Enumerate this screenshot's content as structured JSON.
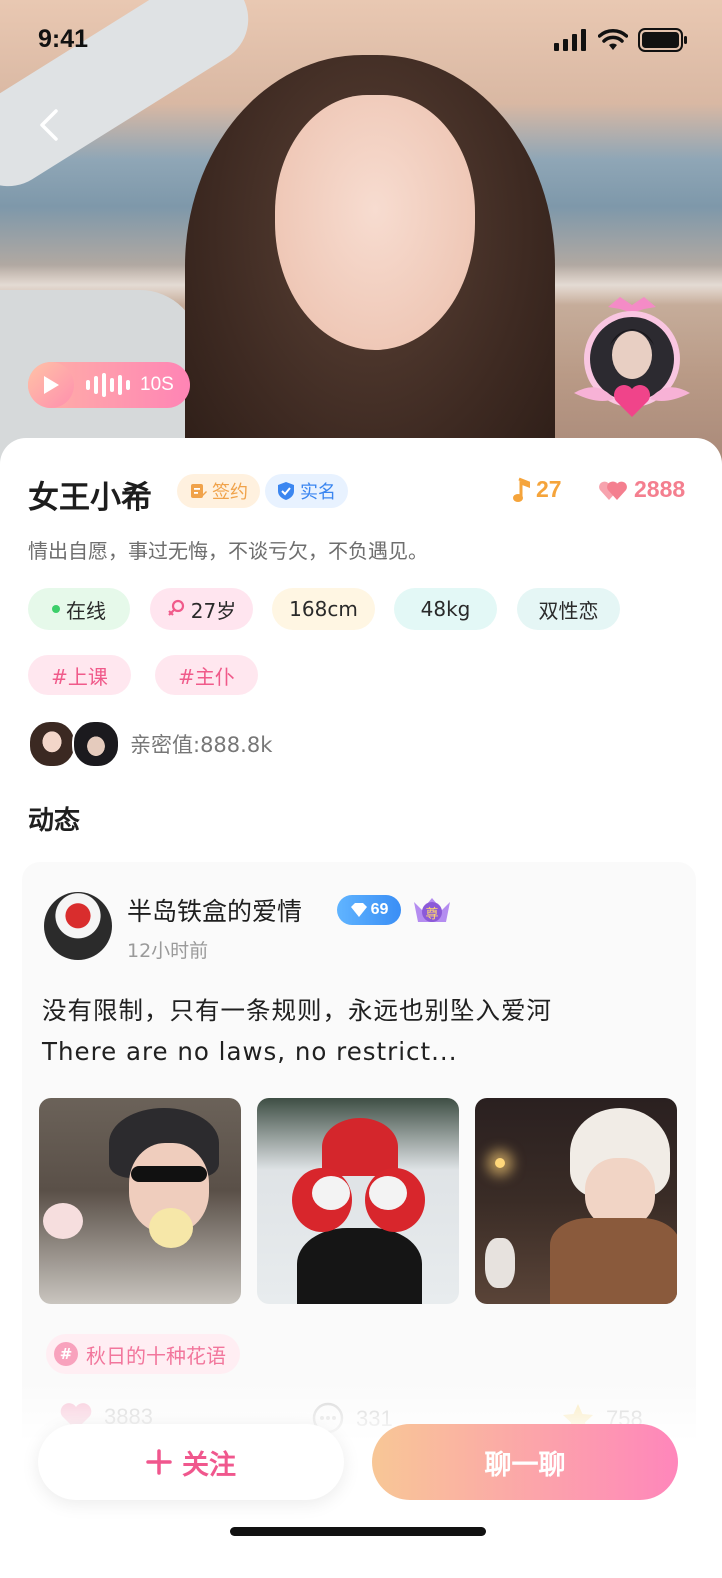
{
  "status_bar": {
    "time": "9:41"
  },
  "voice_intro": {
    "duration": "10S"
  },
  "profile": {
    "name": "女王小希",
    "badges": {
      "signed": "签约",
      "verified": "实名"
    },
    "stats": {
      "music": "27",
      "likes": "2888"
    },
    "bio": "情出自愿，事过无悔，不谈亏欠，不负遇见。",
    "tags": {
      "online": "在线",
      "age": "27岁",
      "height": "168cm",
      "weight": "48kg",
      "orientation": "双性恋"
    },
    "hashtags": [
      "#上课",
      "#主仆"
    ],
    "intimacy": "亲密值:888.8k"
  },
  "feed": {
    "section_title": "动态",
    "post": {
      "user": "半岛铁盒的爱情",
      "vip_level": "69",
      "crown_label": "尊",
      "time": "12小时前",
      "text_line1": "没有限制，只有一条规则，永远也别坠入爱河",
      "text_line2": "There are no laws, no restrict...",
      "topic": "秋日的十种花语",
      "topic_hash": "#",
      "likes": "3883",
      "comments": "331",
      "stars": "758"
    }
  },
  "actions": {
    "follow": "关注",
    "chat": "聊一聊"
  },
  "colors": {
    "accent_pink": "#f0578d",
    "gradient_start": "#f8c796",
    "gradient_end": "#ff86bb"
  }
}
